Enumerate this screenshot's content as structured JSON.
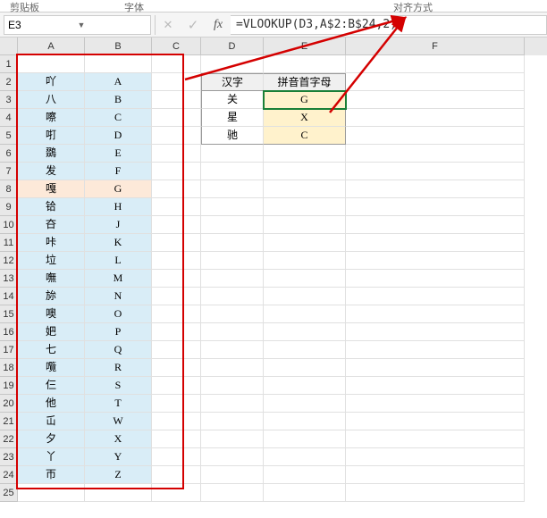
{
  "ribbon": {
    "clipboard": "剪贴板",
    "font": "字体",
    "alignment": "对齐方式"
  },
  "namebox": {
    "value": "E3"
  },
  "formula": {
    "value": "=VLOOKUP(D3,A$2:B$24,2)"
  },
  "columns": [
    "A",
    "B",
    "C",
    "D",
    "E",
    "F"
  ],
  "row_count": 25,
  "lookup_table": [
    {
      "hanzi": "吖",
      "letter": "A"
    },
    {
      "hanzi": "八",
      "letter": "B"
    },
    {
      "hanzi": "嚓",
      "letter": "C"
    },
    {
      "hanzi": "咑",
      "letter": "D"
    },
    {
      "hanzi": "鵽",
      "letter": "E"
    },
    {
      "hanzi": "发",
      "letter": "F"
    },
    {
      "hanzi": "嘎",
      "letter": "G"
    },
    {
      "hanzi": "铪",
      "letter": "H"
    },
    {
      "hanzi": "夻",
      "letter": "J"
    },
    {
      "hanzi": "咔",
      "letter": "K"
    },
    {
      "hanzi": "垃",
      "letter": "L"
    },
    {
      "hanzi": "嘸",
      "letter": "M"
    },
    {
      "hanzi": "旀",
      "letter": "N"
    },
    {
      "hanzi": "噢",
      "letter": "O"
    },
    {
      "hanzi": "妑",
      "letter": "P"
    },
    {
      "hanzi": "七",
      "letter": "Q"
    },
    {
      "hanzi": "囕",
      "letter": "R"
    },
    {
      "hanzi": "仨",
      "letter": "S"
    },
    {
      "hanzi": "他",
      "letter": "T"
    },
    {
      "hanzi": "屲",
      "letter": "W"
    },
    {
      "hanzi": "夕",
      "letter": "X"
    },
    {
      "hanzi": "丫",
      "letter": "Y"
    },
    {
      "hanzi": "帀",
      "letter": "Z"
    }
  ],
  "result_header": {
    "d": "汉字",
    "e": "拼音首字母"
  },
  "result_rows": [
    {
      "d": "关",
      "e": "G"
    },
    {
      "d": "星",
      "e": "X"
    },
    {
      "d": "驰",
      "e": "C"
    }
  ],
  "highlight_row_index": 6
}
